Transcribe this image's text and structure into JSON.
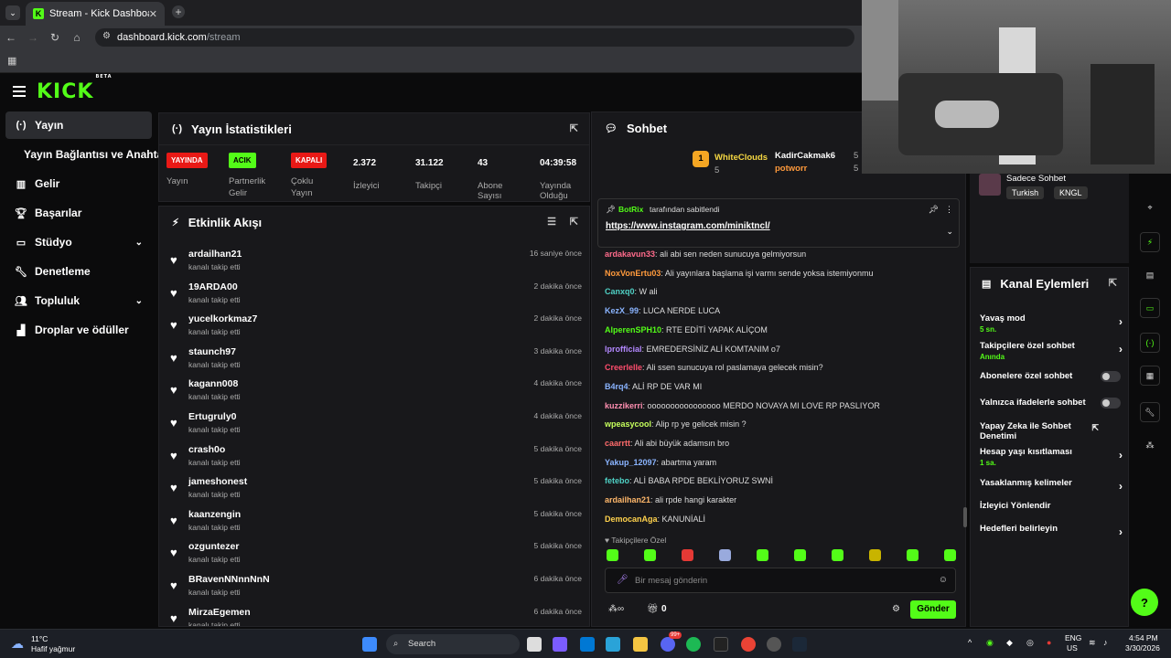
{
  "browser": {
    "tab_title": "Stream - Kick Dashboard",
    "url_domain": "dashboard.kick.com",
    "url_path": "/stream"
  },
  "sidebar": {
    "items": [
      {
        "label": "Yayın",
        "icon": "broadcast-icon"
      },
      {
        "label": "Yayın Bağlantısı ve Anahtarı",
        "icon": ""
      },
      {
        "label": "Gelir",
        "icon": "chart-icon"
      },
      {
        "label": "Başarılar",
        "icon": "trophy-icon"
      },
      {
        "label": "Stüdyo",
        "icon": "studio-icon"
      },
      {
        "label": "Denetleme",
        "icon": "wrench-icon"
      },
      {
        "label": "Topluluk",
        "icon": "people-icon"
      },
      {
        "label": "Droplar ve ödüller",
        "icon": "gift-icon"
      }
    ]
  },
  "stats": {
    "title": "Yayın İstatistikleri",
    "items": [
      {
        "badge": "YAYINDA",
        "badge_color": "#e91916",
        "label": "Yayın"
      },
      {
        "badge": "ACIK",
        "badge_color": "#53fc18",
        "label": "Partnerlik Gelir"
      },
      {
        "badge": "KAPALI",
        "badge_color": "#e91916",
        "label": "Çoklu Yayın"
      },
      {
        "value": "2.372",
        "label": "İzleyici"
      },
      {
        "value": "31.122",
        "label": "Takipçi"
      },
      {
        "value": "43",
        "label": "Abone Sayısı"
      },
      {
        "value": "04:39:58",
        "label": "Yayında Olduğu"
      }
    ]
  },
  "activity": {
    "title": "Etkinlik Akışı",
    "subtitle": "kanalı takip etti",
    "events": [
      {
        "name": "ardailhan21",
        "time": "16 saniye önce"
      },
      {
        "name": "19ARDA00",
        "time": "2 dakika önce"
      },
      {
        "name": "yucelkorkmaz7",
        "time": "2 dakika önce"
      },
      {
        "name": "staunch97",
        "time": "3 dakika önce"
      },
      {
        "name": "kagann008",
        "time": "4 dakika önce"
      },
      {
        "name": "Ertugruly0",
        "time": "4 dakika önce"
      },
      {
        "name": "crash0o",
        "time": "5 dakika önce"
      },
      {
        "name": "jameshonest",
        "time": "5 dakika önce"
      },
      {
        "name": "kaanzengin",
        "time": "5 dakika önce"
      },
      {
        "name": "ozguntezer",
        "time": "5 dakika önce"
      },
      {
        "name": "BRavenNNnnNnN",
        "time": "6 dakika önce"
      },
      {
        "name": "MirzaEgemen",
        "time": "6 dakika önce"
      }
    ]
  },
  "chat": {
    "title": "Sohbet",
    "leader1": {
      "name": "WhiteClouds",
      "count": "5"
    },
    "leader2": {
      "name": "KadirCakmak6",
      "count": "5"
    },
    "leader3": {
      "name": "potworr",
      "count": "5"
    },
    "pinned_by": "BotRix",
    "pinned_by_suffix": "tarafından sabitlendi",
    "pinned_link": "https://www.instagram.com/miniktncl/",
    "messages": [
      {
        "user": "ardakavun33",
        "color": "#ff6b8b",
        "text": "ali abi sen neden sunucuya gelmiyorsun"
      },
      {
        "user": "NoxVonErtu03",
        "color": "#ff9a3c",
        "text": "Ali yayınlara başlama işi varmı sende yoksa istemiyonmu"
      },
      {
        "user": "Canxq0",
        "color": "#4fd1c5",
        "text": "W ali"
      },
      {
        "user": "KezX_99",
        "color": "#8ab4ff",
        "text": "LUCA NERDE LUCA"
      },
      {
        "user": "AlperenSPH10",
        "color": "#53fc18",
        "text": "RTE EDİTİ YAPAK ALİÇOM"
      },
      {
        "user": "lprofficial",
        "color": "#b388ff",
        "text": "EMREDERSİNİZ ALİ KOMTANIM o7"
      },
      {
        "user": "Creerlelle",
        "color": "#ff4d6d",
        "text": "Ali ssen sunucuya rol paslamaya gelecek misin?"
      },
      {
        "user": "B4rq4",
        "color": "#8ab4ff",
        "text": "ALİ RP DE VAR MI"
      },
      {
        "user": "kuzzikerri",
        "color": "#ff8fb1",
        "text": "oooooooooooooooo MERDO NOVAYA MI LOVE RP PASLIYOR"
      },
      {
        "user": "wpeasycool",
        "color": "#c6ff5c",
        "text": "Alip rp ye gelicek misin ?"
      },
      {
        "user": "caarrtt",
        "color": "#ff6b6b",
        "text": "Ali abi büyük adamsın bro"
      },
      {
        "user": "Yakup_12097",
        "color": "#8ab4ff",
        "text": "abartma yaram"
      },
      {
        "user": "fetebo",
        "color": "#4fd1c5",
        "text": "ALİ BABA RPDE BEKLİYORUZ SWNİ"
      },
      {
        "user": "ardailhan21",
        "color": "#ffb86b",
        "text": "ali rpde hangi karakter"
      },
      {
        "user": "DemocanAga",
        "color": "#ffd24d",
        "text": "KANUNİALİ"
      }
    ],
    "followers_only": "Takipçilere Özel",
    "input_placeholder": "Bir mesaj gönderin",
    "points": "0",
    "send_label": "Gönder"
  },
  "right_top": {
    "title": "Sadece Sohbet",
    "tags": [
      "Turkish",
      "KNGL"
    ]
  },
  "channel_actions": {
    "title": "Kanal Eylemleri",
    "items": [
      {
        "label": "Yavaş mod",
        "sub": "5 sn.",
        "type": "chevron"
      },
      {
        "label": "Takipçilere özel sohbet",
        "sub": "Anında",
        "type": "chevron"
      },
      {
        "label": "Abonelere özel sohbet",
        "sub": "",
        "type": "toggle"
      },
      {
        "label": "Yalnızca ifadelerle sohbet",
        "sub": "",
        "type": "toggle"
      },
      {
        "label": "Yapay Zeka ile Sohbet Denetimi",
        "sub": "",
        "type": "external"
      },
      {
        "label": "Hesap yaşı kısıtlaması",
        "sub": "1 sa.",
        "type": "chevron"
      },
      {
        "label": "Yasaklanmış kelimeler",
        "sub": "",
        "type": "chevron"
      },
      {
        "label": "İzleyici Yönlendir",
        "sub": "",
        "type": "none"
      },
      {
        "label": "Hedefleri belirleyin",
        "sub": "",
        "type": "chevron"
      }
    ]
  },
  "taskbar": {
    "weather_temp": "11°C",
    "weather_desc": "Hafif yağmur",
    "search": "Search",
    "lang1": "ENG",
    "lang2": "US",
    "time": "4:54 PM",
    "date": "3/30/2026",
    "discord_badge": "99+"
  }
}
